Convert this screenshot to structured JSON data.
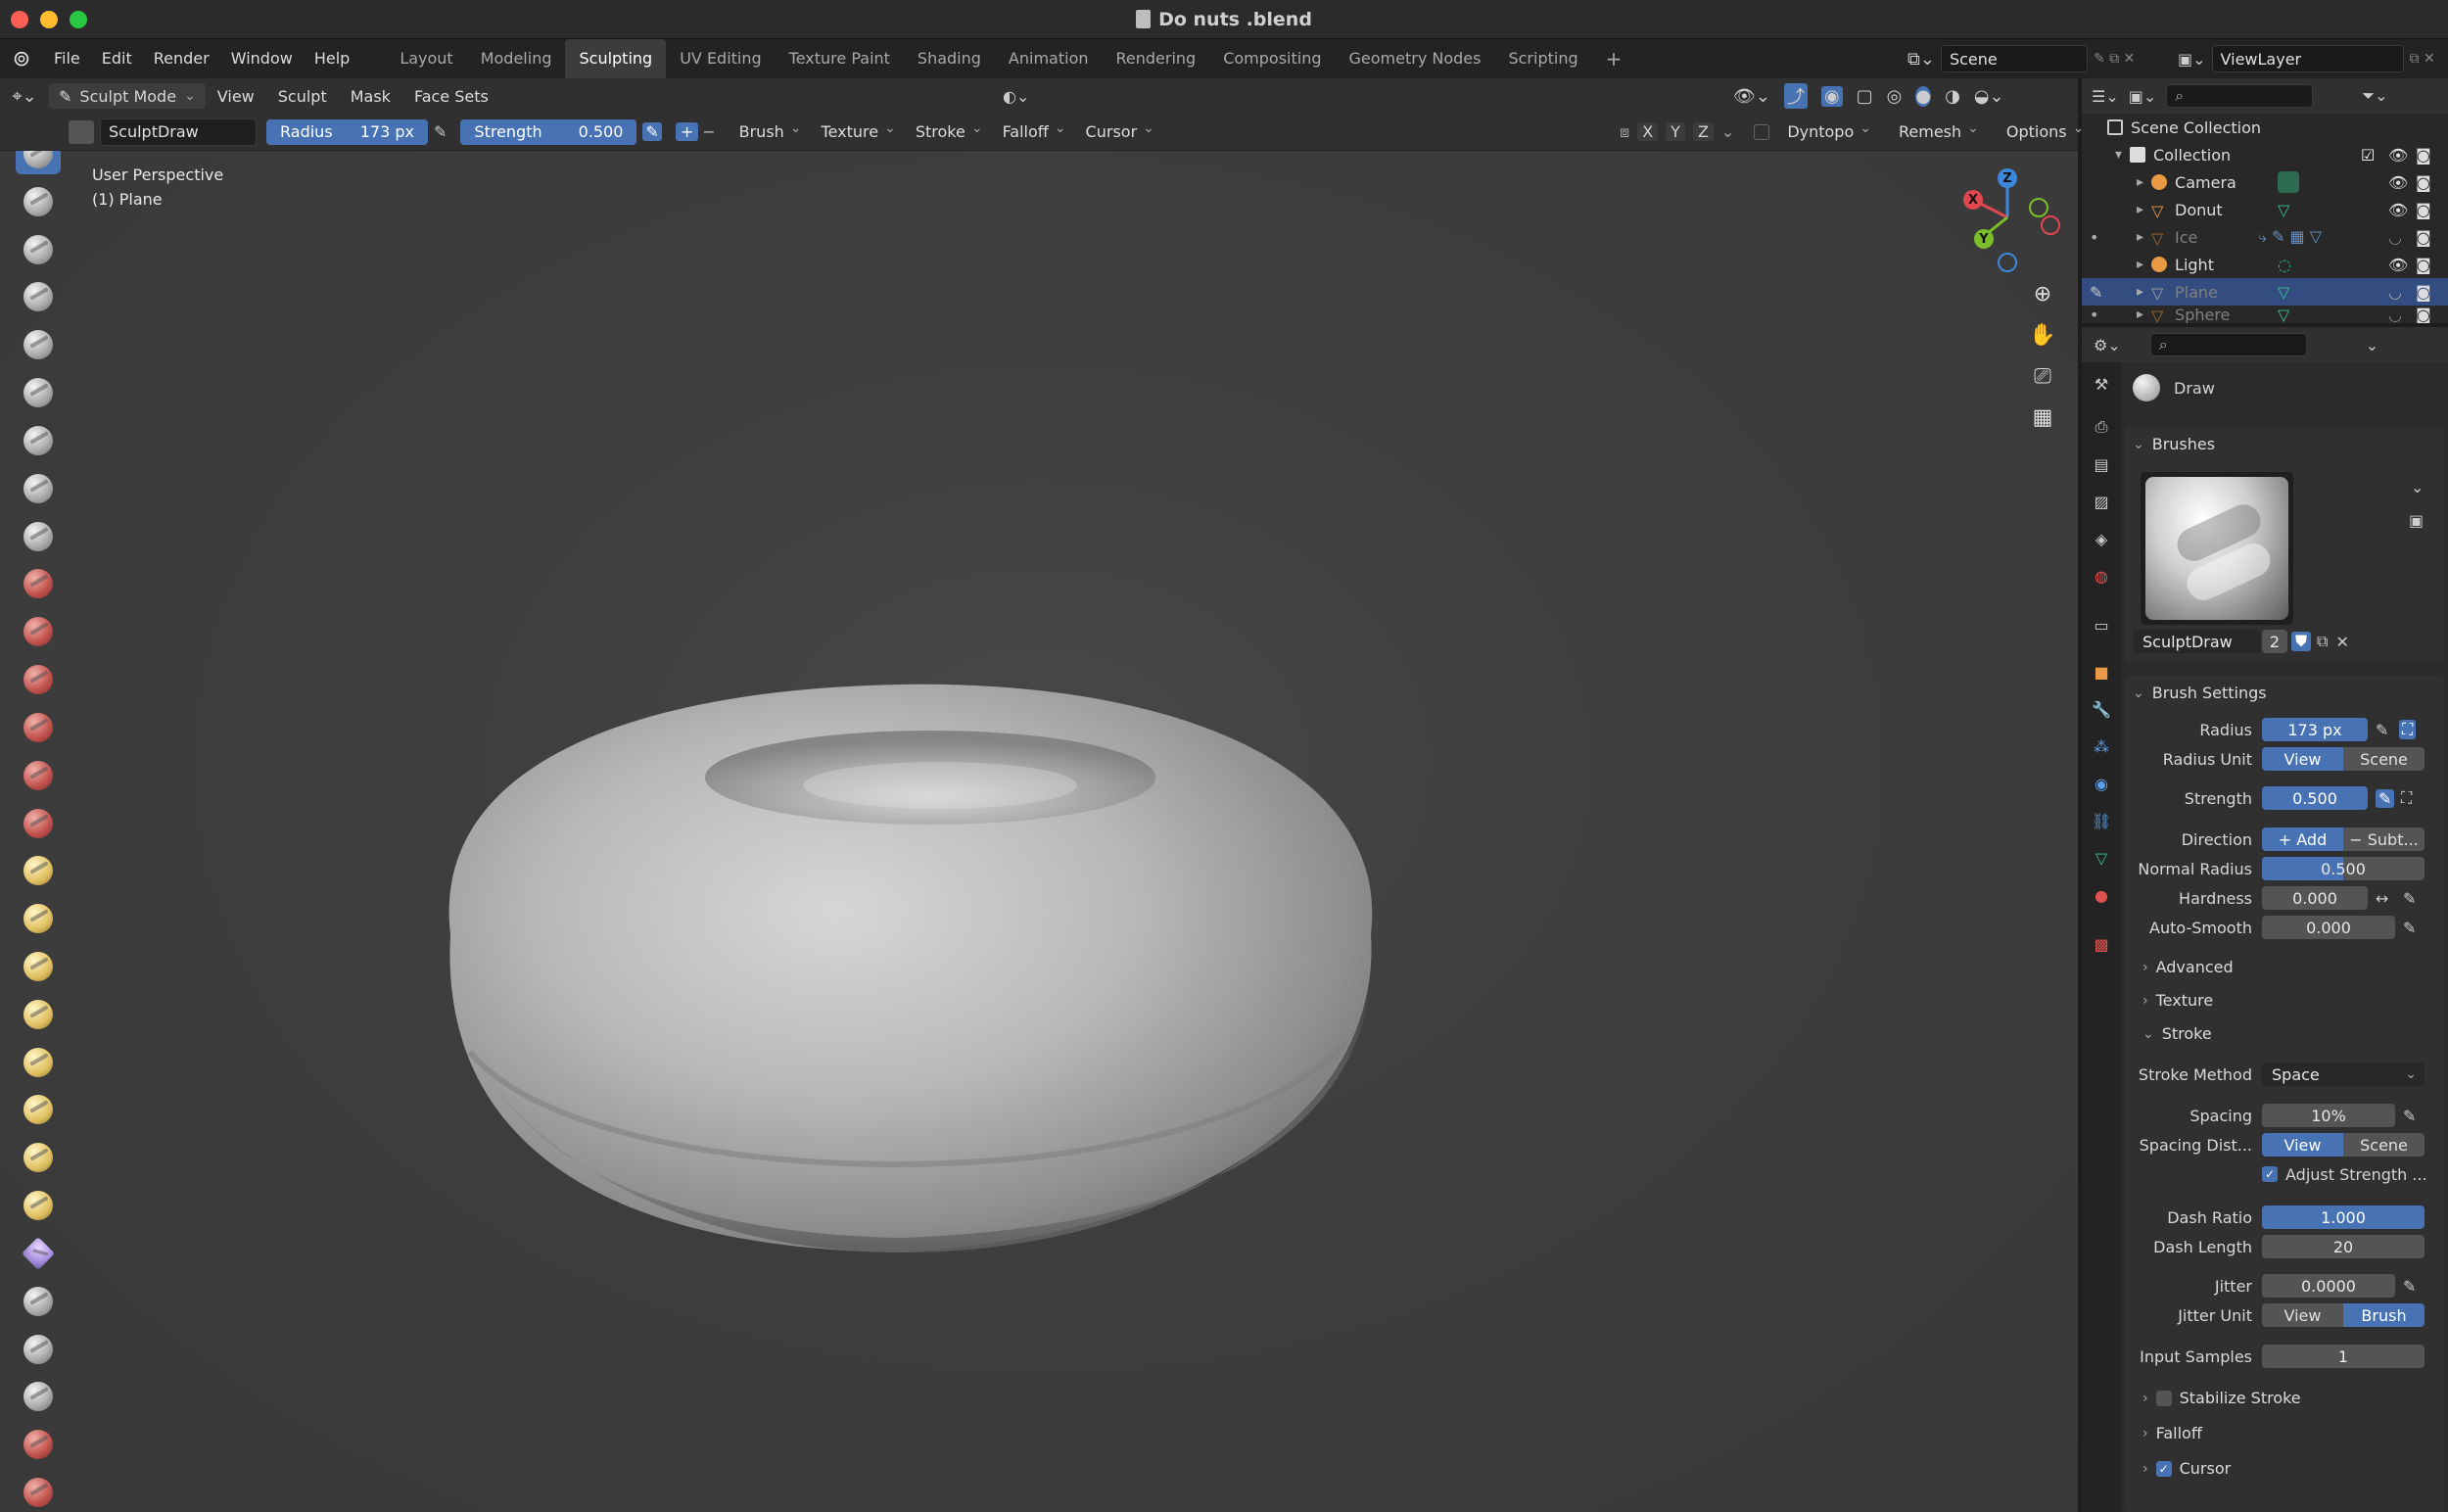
{
  "window": {
    "title": "Do nuts .blend"
  },
  "menubar": {
    "menus": [
      "File",
      "Edit",
      "Render",
      "Window",
      "Help"
    ],
    "workspaces": [
      "Layout",
      "Modeling",
      "Sculpting",
      "UV Editing",
      "Texture Paint",
      "Shading",
      "Animation",
      "Rendering",
      "Compositing",
      "Geometry Nodes",
      "Scripting"
    ],
    "active_workspace": "Sculpting",
    "add_tab": "+",
    "scene": "Scene",
    "view_layer": "ViewLayer"
  },
  "header": {
    "mode": "Sculpt Mode",
    "menus": [
      "View",
      "Sculpt",
      "Mask",
      "Face Sets"
    ],
    "brush_name": "SculptDraw",
    "radius_label": "Radius",
    "radius_value": "173 px",
    "strength_label": "Strength",
    "strength_value": "0.500",
    "dropdowns": [
      "Brush",
      "Texture",
      "Stroke",
      "Falloff",
      "Cursor"
    ],
    "axes": [
      "X",
      "Y",
      "Z"
    ],
    "dyntopo": "Dyntopo",
    "remesh": "Remesh",
    "options": "Options"
  },
  "viewport": {
    "perspective": "User Perspective",
    "object": "(1) Plane",
    "gizmo_axes": [
      "X",
      "Y",
      "Z"
    ],
    "colors": {
      "x": "#e0474f",
      "y": "#7bbd2a",
      "z": "#3b88dd",
      "active_tool": "#4772b3"
    }
  },
  "outliner": {
    "root": "Scene Collection",
    "collection": "Collection",
    "items": [
      {
        "name": "Camera",
        "state": "visible"
      },
      {
        "name": "Donut",
        "state": "visible"
      },
      {
        "name": "Ice",
        "state": "hidden"
      },
      {
        "name": "Light",
        "state": "visible"
      },
      {
        "name": "Plane",
        "state": "selected"
      },
      {
        "name": "Sphere",
        "state": "hidden"
      }
    ]
  },
  "properties": {
    "tool_name": "Draw",
    "brushes_title": "Brushes",
    "brush_name": "SculptDraw",
    "brush_users": "2",
    "brush_settings_title": "Brush Settings",
    "radius": {
      "label": "Radius",
      "value": "173 px"
    },
    "radius_unit": {
      "label": "Radius Unit",
      "options": [
        "View",
        "Scene"
      ],
      "selected": "View"
    },
    "strength": {
      "label": "Strength",
      "value": "0.500"
    },
    "direction": {
      "label": "Direction",
      "options": [
        "Add",
        "Subt..."
      ],
      "selected": "Add"
    },
    "normal_radius": {
      "label": "Normal Radius",
      "value": "0.500",
      "fraction": 0.5
    },
    "hardness": {
      "label": "Hardness",
      "value": "0.000"
    },
    "auto_smooth": {
      "label": "Auto-Smooth",
      "value": "0.000"
    },
    "advanced": "Advanced",
    "texture": "Texture",
    "stroke": "Stroke",
    "stroke_method": {
      "label": "Stroke Method",
      "value": "Space"
    },
    "spacing": {
      "label": "Spacing",
      "value": "10%"
    },
    "spacing_distance": {
      "label": "Spacing Dist...",
      "options": [
        "View",
        "Scene"
      ],
      "selected": "View"
    },
    "adjust_strength": "Adjust Strength ...",
    "dash_ratio": {
      "label": "Dash Ratio",
      "value": "1.000"
    },
    "dash_length": {
      "label": "Dash Length",
      "value": "20"
    },
    "jitter": {
      "label": "Jitter",
      "value": "0.0000"
    },
    "jitter_unit": {
      "label": "Jitter Unit",
      "options": [
        "View",
        "Brush"
      ],
      "selected": "Brush"
    },
    "input_samples": {
      "label": "Input Samples",
      "value": "1"
    },
    "stabilize_stroke": "Stabilize Stroke",
    "falloff": "Falloff",
    "cursor": "Cursor"
  }
}
